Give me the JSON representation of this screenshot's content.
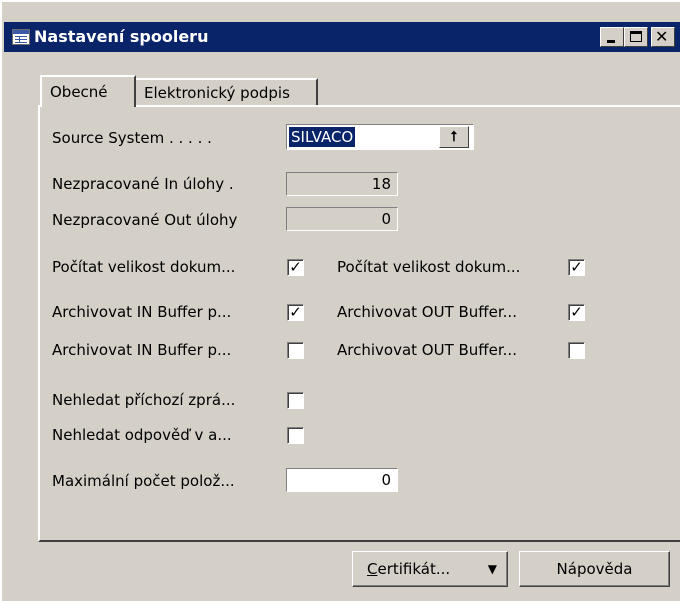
{
  "window": {
    "title": "Nastavení spooleru",
    "icon": "table-icon"
  },
  "tabs": [
    {
      "label": "Obecné",
      "active": true
    },
    {
      "label": "Elektronický podpis",
      "active": false
    }
  ],
  "form": {
    "source_system": {
      "label": "Source System . . . . .",
      "value": "SILVACO"
    },
    "nezpracovane_in": {
      "label": "Nezpracované In úlohy .",
      "value": "18"
    },
    "nezpracovane_out": {
      "label": "Nezpracované Out úlohy",
      "value": "0"
    },
    "checks_left": [
      {
        "label": "Počítat velikost dokum...",
        "checked": true
      },
      {
        "label": "Archivovat IN Buffer p...",
        "checked": true
      },
      {
        "label": "Archivovat IN Buffer p...",
        "checked": false
      }
    ],
    "checks_right": [
      {
        "label": "Počítat velikost dokum...",
        "checked": true
      },
      {
        "label": "Archivovat OUT Buffer...",
        "checked": true
      },
      {
        "label": "Archivovat OUT Buffer...",
        "checked": false
      }
    ],
    "checks_lower": [
      {
        "label": "Nehledat příchozí zprá...",
        "checked": false
      },
      {
        "label": "Nehledat odpověď v a...",
        "checked": false
      }
    ],
    "max_pocet": {
      "label": "Maximální počet polož...",
      "value": "0"
    }
  },
  "buttons": {
    "cert_first": "C",
    "cert_rest": "ertifikát...",
    "help": "Nápověda"
  },
  "check_glyph": "✓"
}
